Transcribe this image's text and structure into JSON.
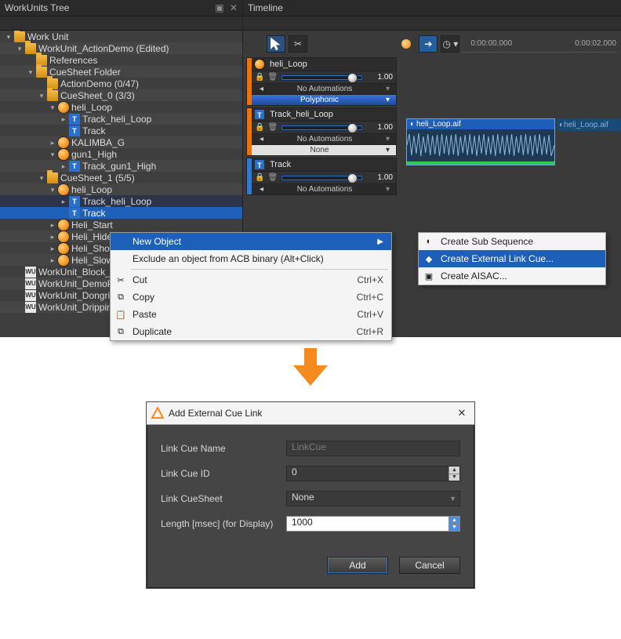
{
  "tree_panel": {
    "title": "WorkUnits Tree",
    "items": [
      {
        "depth": 0,
        "expand": "▾",
        "icon": "folder",
        "label": "Work Unit",
        "alt": false
      },
      {
        "depth": 1,
        "expand": "▾",
        "icon": "folder",
        "label": "WorkUnit_ActionDemo (Edited)",
        "alt": true
      },
      {
        "depth": 2,
        "expand": "",
        "icon": "folder",
        "label": "References",
        "alt": false
      },
      {
        "depth": 2,
        "expand": "▾",
        "icon": "folder",
        "label": "CueSheet Folder",
        "alt": true
      },
      {
        "depth": 3,
        "expand": "",
        "icon": "folder",
        "label": "ActionDemo (0/47)",
        "alt": false
      },
      {
        "depth": 3,
        "expand": "▾",
        "icon": "folder",
        "label": "CueSheet_0 (3/3)",
        "alt": true
      },
      {
        "depth": 4,
        "expand": "▾",
        "icon": "cue",
        "label": "heli_Loop",
        "alt": false
      },
      {
        "depth": 5,
        "expand": "▸",
        "icon": "track",
        "label": "Track_heli_Loop",
        "alt": true
      },
      {
        "depth": 5,
        "expand": "",
        "icon": "track",
        "label": "Track",
        "alt": false
      },
      {
        "depth": 4,
        "expand": "▸",
        "icon": "cue",
        "label": "KALIMBA_G",
        "alt": true
      },
      {
        "depth": 4,
        "expand": "▾",
        "icon": "cue",
        "label": "gun1_High",
        "alt": false
      },
      {
        "depth": 5,
        "expand": "▸",
        "icon": "track",
        "label": "Track_gun1_High",
        "alt": true
      },
      {
        "depth": 3,
        "expand": "▾",
        "icon": "folder",
        "label": "CueSheet_1 (5/5)",
        "alt": false
      },
      {
        "depth": 4,
        "expand": "▾",
        "icon": "cue",
        "label": "heli_Loop",
        "alt": true
      },
      {
        "depth": 5,
        "expand": "▸",
        "icon": "track",
        "label": "Track_heli_Loop",
        "alt": false,
        "sel": "sel2"
      },
      {
        "depth": 5,
        "expand": "",
        "icon": "track",
        "label": "Track",
        "alt": true,
        "sel": "sel"
      },
      {
        "depth": 4,
        "expand": "▸",
        "icon": "cue",
        "label": "Heli_Start",
        "alt": false
      },
      {
        "depth": 4,
        "expand": "▸",
        "icon": "cue",
        "label": "Heli_Hide",
        "alt": true
      },
      {
        "depth": 4,
        "expand": "▸",
        "icon": "cue",
        "label": "Heli_Show",
        "alt": false
      },
      {
        "depth": 4,
        "expand": "▸",
        "icon": "cue",
        "label": "Heli_SlowDow",
        "alt": true
      },
      {
        "depth": 1,
        "expand": "",
        "icon": "wu",
        "label": "WorkUnit_Block_In",
        "alt": false
      },
      {
        "depth": 1,
        "expand": "",
        "icon": "wu",
        "label": "WorkUnit_DemoPr",
        "alt": true
      },
      {
        "depth": 1,
        "expand": "",
        "icon": "wu",
        "label": "WorkUnit_Dongri",
        "alt": false
      },
      {
        "depth": 1,
        "expand": "",
        "icon": "wu",
        "label": "WorkUnit_Dripping",
        "alt": true
      }
    ]
  },
  "timeline_panel": {
    "title": "Timeline",
    "ruler": [
      "0:00:00.000",
      "0:00:02.000"
    ],
    "tracks": [
      {
        "stripe": "orange",
        "icon": "cue",
        "name": "heli_Loop",
        "value": "1.00",
        "automation": "No Automations",
        "mode": "Polyphonic",
        "modeClass": "mode-poly"
      },
      {
        "stripe": "orange",
        "icon": "track",
        "name": "Track_heli_Loop",
        "value": "1.00",
        "automation": "No Automations",
        "mode": "None",
        "modeClass": "mode-none"
      },
      {
        "stripe": "blue",
        "icon": "track",
        "name": "Track",
        "value": "1.00",
        "automation": "No Automations",
        "mode": "",
        "modeClass": ""
      }
    ],
    "clip_name": "heli_Loop.aif",
    "clip2_name": "heli_Loop.aif"
  },
  "context_menu": {
    "items": [
      {
        "label": "New Object",
        "arrow": true,
        "hover": true
      },
      {
        "label": "Exclude an object from ACB binary (Alt+Click)"
      },
      {
        "sep": true
      },
      {
        "label": "Cut",
        "shortcut": "Ctrl+X",
        "icon": "✂"
      },
      {
        "label": "Copy",
        "shortcut": "Ctrl+C",
        "icon": "⧉"
      },
      {
        "label": "Paste",
        "shortcut": "Ctrl+V",
        "icon": "📋"
      },
      {
        "label": "Duplicate",
        "shortcut": "Ctrl+R",
        "icon": "⧉"
      }
    ]
  },
  "sub_menu": {
    "items": [
      {
        "label": "Create Sub Sequence",
        "icon": "◐"
      },
      {
        "label": "Create External Link Cue...",
        "icon": "◆",
        "hover": true
      },
      {
        "label": "Create AISAC...",
        "icon": "▣"
      }
    ]
  },
  "dialog": {
    "title": "Add External Cue Link",
    "fields": {
      "name_label": "Link Cue Name",
      "name_placeholder": "LinkCue",
      "id_label": "Link Cue ID",
      "id_value": "0",
      "sheet_label": "Link CueSheet",
      "sheet_value": "None",
      "length_label": "Length [msec] (for Display)",
      "length_value": "1000"
    },
    "add": "Add",
    "cancel": "Cancel"
  }
}
